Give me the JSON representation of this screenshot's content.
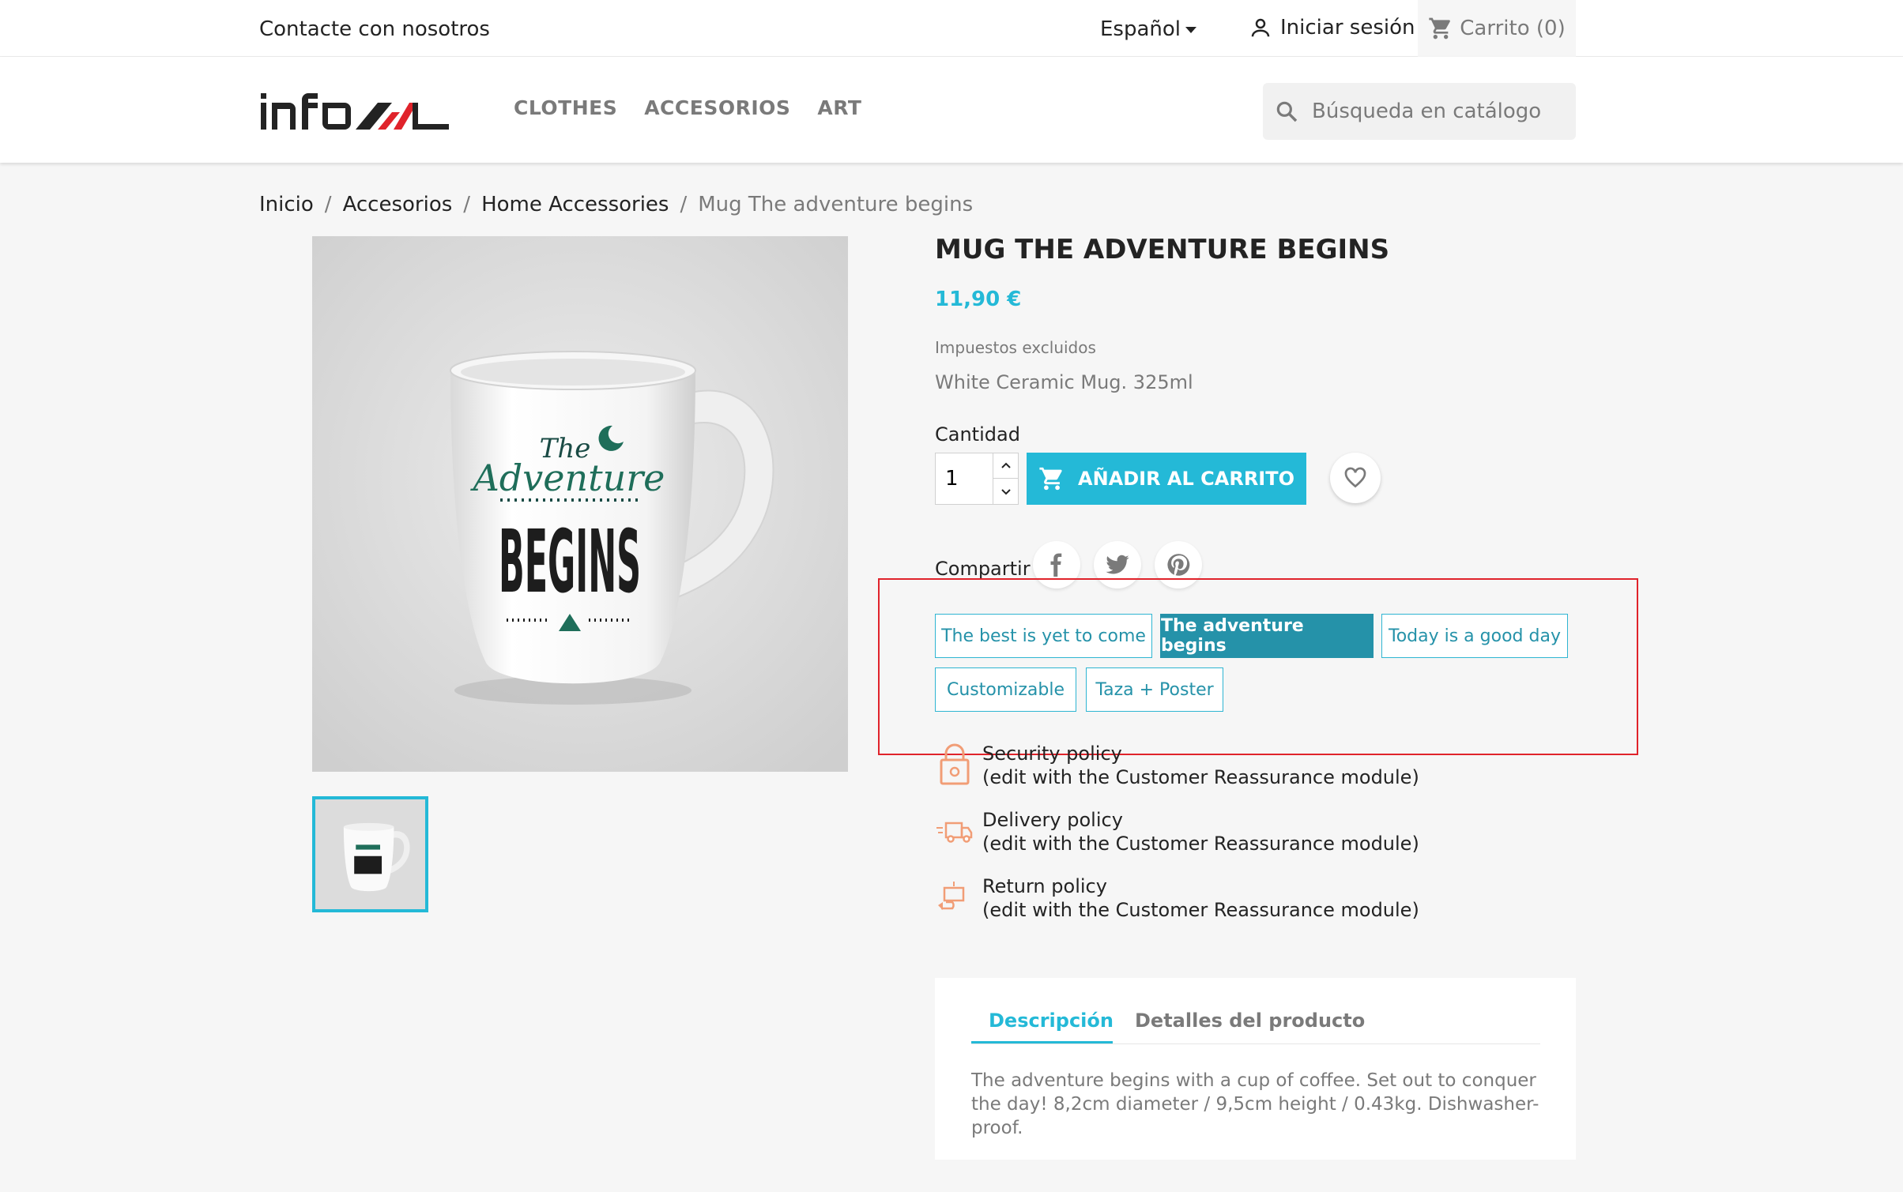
{
  "topbar": {
    "contact": "Contacte con nosotros",
    "language": "Español",
    "signin": "Iniciar sesión",
    "cart": "Carrito (0)"
  },
  "header": {
    "logo_text": "infoal",
    "nav": [
      "CLOTHES",
      "ACCESORIOS",
      "ART"
    ],
    "search_placeholder": "Búsqueda en catálogo"
  },
  "breadcrumb": [
    "Inicio",
    "Accesorios",
    "Home Accessories",
    "Mug The adventure begins"
  ],
  "product": {
    "title": "MUG THE ADVENTURE BEGINS",
    "price": "11,90 €",
    "tax_note": "Impuestos excluidos",
    "short_desc": "White Ceramic Mug. 325ml",
    "qty_label": "Cantidad",
    "qty_value": "1",
    "add_to_cart": "AÑADIR AL CARRITO",
    "share_label": "Compartir",
    "mug_print": {
      "line1": "The",
      "line2": "Adventure",
      "line3": "BEGINS"
    }
  },
  "variants": [
    {
      "label": "The best is yet to come",
      "active": false
    },
    {
      "label": "The adventure begins",
      "active": true
    },
    {
      "label": "Today is a good day",
      "active": false
    },
    {
      "label": "Customizable",
      "active": false
    },
    {
      "label": "Taza + Poster",
      "active": false
    }
  ],
  "reassurance": [
    {
      "title": "Security policy",
      "desc": "(edit with the Customer Reassurance module)",
      "icon": "lock-icon"
    },
    {
      "title": "Delivery policy",
      "desc": "(edit with the Customer Reassurance module)",
      "icon": "truck-icon"
    },
    {
      "title": "Return policy",
      "desc": "(edit with the Customer Reassurance module)",
      "icon": "return-box-icon"
    }
  ],
  "tabs": {
    "labels": [
      "Descripción",
      "Detalles del producto"
    ],
    "description": "The adventure begins with a cup of coffee. Set out to conquer the day! 8,2cm diameter / 9,5cm height / 0.43kg. Dishwasher-proof."
  },
  "colors": {
    "accent": "#24b9d7",
    "variant_active": "#2592a9",
    "highlight_border": "#e0232b",
    "reassurance_icon": "#f19d76"
  }
}
